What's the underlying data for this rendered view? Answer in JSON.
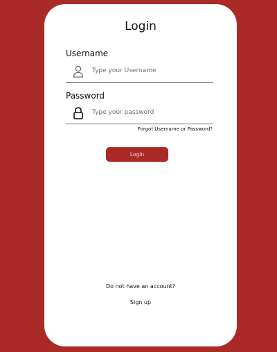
{
  "colors": {
    "background": "#a92a27",
    "card": "#ffffff",
    "button": "#a92a27"
  },
  "login_card": {
    "title": "Login",
    "username": {
      "label": "Username",
      "placeholder": "Type your Username",
      "value": "",
      "icon": "user-icon"
    },
    "password": {
      "label": "Password",
      "placeholder": "Type your password",
      "value": "",
      "icon": "lock-icon"
    },
    "forgot_link": "Forgot Username or Password?",
    "login_button": "Login",
    "no_account_text": "Do not have an account?",
    "signup_link": "Sign up"
  }
}
